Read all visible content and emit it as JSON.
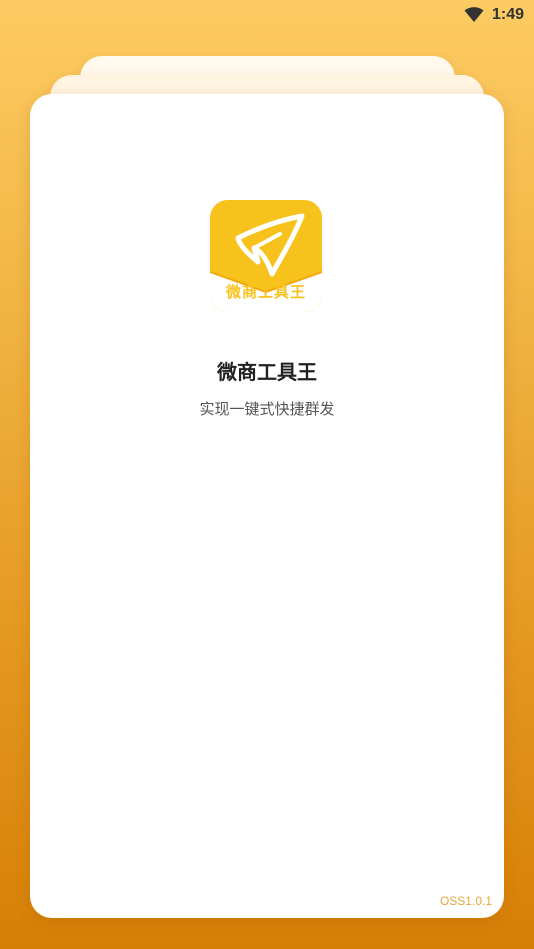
{
  "status_bar": {
    "time": "1:49",
    "wifi_icon": "wifi-icon"
  },
  "splash": {
    "logo_icon": "paper-plane-icon",
    "logo_text": "微商工具王",
    "app_name": "微商工具王",
    "slogan": "实现一键式快捷群发",
    "version": "OSS1.0.1"
  },
  "colors": {
    "background_top": "#FDCB63",
    "background_bottom": "#D67F06",
    "logo_yellow": "#F7C21C",
    "version_text": "#E8A53A"
  }
}
